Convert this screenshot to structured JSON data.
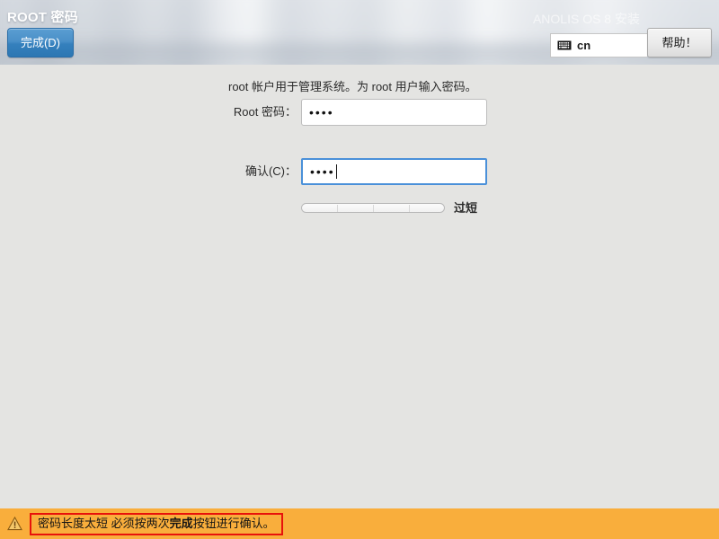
{
  "header": {
    "title": "ROOT 密码",
    "product_title": "ANOLIS OS 8 安装",
    "done_label": "完成(D)",
    "help_label": "帮助！",
    "keyboard_layout": "cn",
    "keyboard_icon": "keyboard-icon"
  },
  "main": {
    "description": "root 帐户用于管理系统。为 root 用户输入密码。",
    "fields": [
      {
        "label": "Root 密码：",
        "value": "••••",
        "focused": false
      },
      {
        "label": "确认(C)：",
        "value": "••••",
        "focused": true
      }
    ],
    "strength": {
      "caption": "过短",
      "percent": 0,
      "segments": 4
    }
  },
  "footer": {
    "icon": "warning-triangle-icon",
    "message_prefix": "密码长度太短 必须按两次",
    "message_bold": "完成",
    "message_suffix": "按钮进行确认。"
  },
  "colors": {
    "accent_blue": "#4a90d9",
    "done_button": "#3580bd",
    "warning_bar": "#f9ae3c",
    "warning_border": "#e8120b",
    "content_bg": "#e4e4e2"
  }
}
